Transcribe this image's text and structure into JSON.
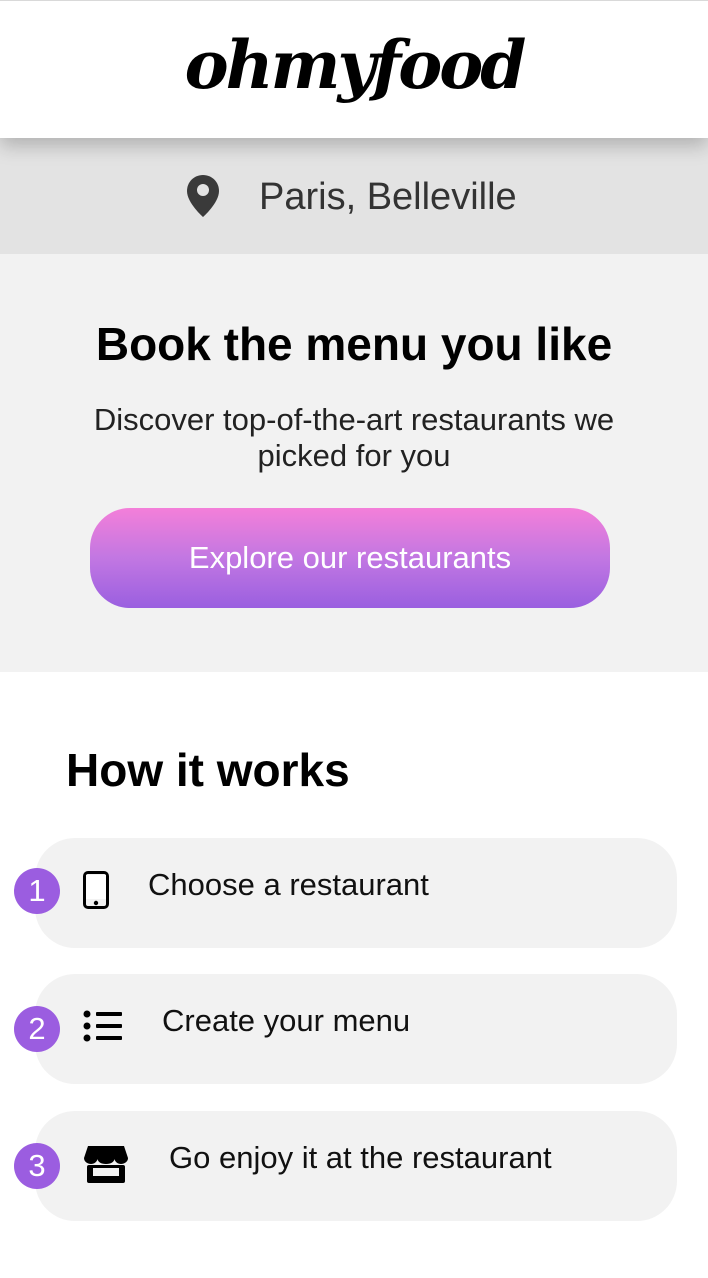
{
  "header": {
    "logo_text": "ohmyfood"
  },
  "location": {
    "icon": "map-pin-icon",
    "label": "Paris, Belleville"
  },
  "hero": {
    "title": "Book the menu you like",
    "subtitle": "Discover top-of-the-art restaurants we picked for you",
    "cta_label": "Explore our restaurants"
  },
  "how_it_works": {
    "title": "How it works",
    "steps": [
      {
        "number": "1",
        "icon": "smartphone-icon",
        "label": "Choose a restaurant"
      },
      {
        "number": "2",
        "icon": "list-icon",
        "label": "Create your menu"
      },
      {
        "number": "3",
        "icon": "store-icon",
        "label": "Go enjoy it at the restaurant"
      }
    ]
  },
  "colors": {
    "accent": "#9b5de0",
    "cta_gradient_top": "#f47fd9",
    "cta_gradient_bottom": "#9a5fe0",
    "location_bar_bg": "#e3e3e3",
    "hero_bg": "#f2f2f2",
    "step_bg": "#f2f2f2"
  }
}
